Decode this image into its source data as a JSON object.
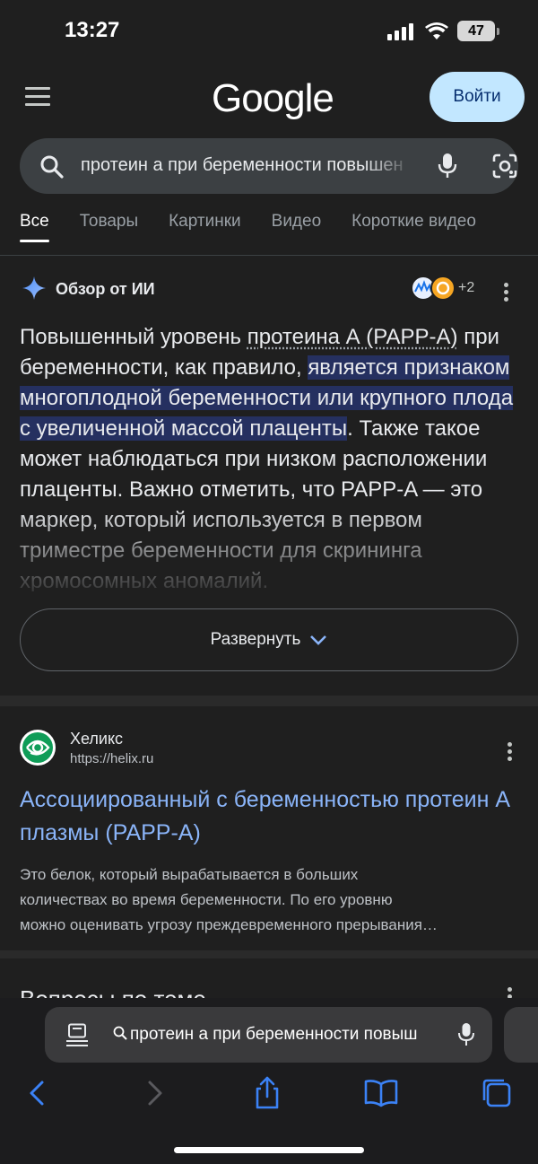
{
  "status": {
    "time": "13:27",
    "battery": "47"
  },
  "header": {
    "logo": "Google",
    "login_label": "Войти"
  },
  "search": {
    "query": "протеин а при беременности повышен"
  },
  "tabs": [
    {
      "label": "Все",
      "active": true
    },
    {
      "label": "Товары"
    },
    {
      "label": "Картинки"
    },
    {
      "label": "Видео"
    },
    {
      "label": "Короткие видео"
    }
  ],
  "ai_overview": {
    "title": "Обзор от ИИ",
    "sources_more": "+2",
    "text_part1": "Повышенный уровень ",
    "text_link": "протеина А (PAPP-A)",
    "text_part2": " при беременности, как правило, ",
    "text_highlight": "является признаком многоплодной беременности или крупного плода с увеличенной массой плаценты",
    "text_part3": ". Также такое может наблюдаться при низком расположении плаценты. Важно отметить, что PAPP-A — это маркер, который используется в первом триместре беременности для скрининга хромосомных аномалий.",
    "expand_label": "Развернуть"
  },
  "result": {
    "site_name": "Хеликс",
    "site_url": "https://helix.ru",
    "title": "Ассоциированный с беременностью протеин А плазмы (PAPP-A)",
    "snippet_lines": [
      "Это белок, который вырабатывается в больших",
      "количествах во время беременности. По его уровню",
      "можно оценивать угрозу преждевременного прерывания…"
    ]
  },
  "related": {
    "title": "Вопросы по теме"
  },
  "browser": {
    "address_text": "протеин а при беременности повыш"
  },
  "colors": {
    "background": "#1f1f1f",
    "accent": "#c2e7ff",
    "link": "#8ab4f8",
    "highlight": "#253060"
  }
}
